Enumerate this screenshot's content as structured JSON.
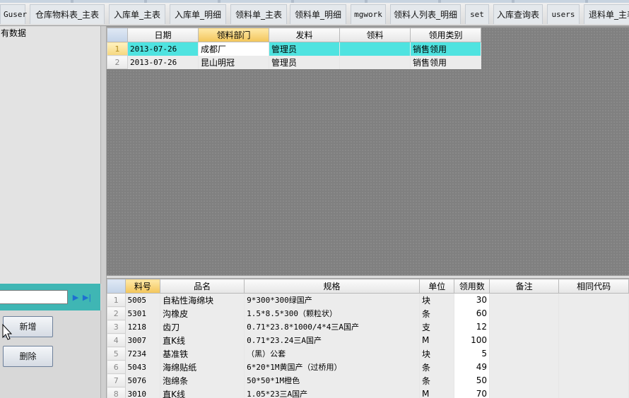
{
  "tabs": [
    "Guser",
    "仓库物料表_主表",
    "入库单_主表",
    "入库单_明细",
    "领料单_主表",
    "领料单_明细",
    "mgwork",
    "领料人列表_明细",
    "set",
    "入库查询表",
    "users",
    "退料单_主表"
  ],
  "left_panel": {
    "message": "有数据",
    "new_button": "新增",
    "delete_button": "删除",
    "nav_next": "▶",
    "nav_last": "▶|"
  },
  "top_grid": {
    "columns": [
      "日期",
      "领料部门",
      "发料",
      "领料",
      "领用类别"
    ],
    "rows": [
      {
        "num": "1",
        "cells": [
          "2013-07-26",
          "成都厂",
          "管理员",
          "",
          "销售领用"
        ]
      },
      {
        "num": "2",
        "cells": [
          "2013-07-26",
          "昆山明冠",
          "管理员",
          "",
          "销售领用"
        ]
      }
    ]
  },
  "bottom_grid": {
    "columns": [
      "料号",
      "品名",
      "规格",
      "单位",
      "领用数",
      "备注",
      "相同代码"
    ],
    "rows": [
      {
        "num": "1",
        "cells": [
          "5005",
          "自粘性海绵块",
          "9*300*300绿国产",
          "块",
          "30",
          "",
          ""
        ]
      },
      {
        "num": "2",
        "cells": [
          "5301",
          "沟橡皮",
          "1.5*8.5*300（颗粒状）",
          "条",
          "60",
          "",
          ""
        ]
      },
      {
        "num": "3",
        "cells": [
          "1218",
          "齿刀",
          "0.71*23.8*1000/4*4三A国产",
          "支",
          "12",
          "",
          ""
        ]
      },
      {
        "num": "4",
        "cells": [
          "3007",
          "直K线",
          "0.71*23.24三A国产",
          "M",
          "100",
          "",
          ""
        ]
      },
      {
        "num": "5",
        "cells": [
          "7234",
          "基准铁",
          "（黑）公套",
          "块",
          "5",
          "",
          ""
        ]
      },
      {
        "num": "6",
        "cells": [
          "5043",
          "海绵贴纸",
          "6*20*1M黄国产（过桥用）",
          "条",
          "49",
          "",
          ""
        ]
      },
      {
        "num": "7",
        "cells": [
          "5076",
          "泡绵条",
          "50*50*1M橙色",
          "条",
          "50",
          "",
          ""
        ]
      },
      {
        "num": "8",
        "cells": [
          "3010",
          "直K线",
          "1.05*23三A国产",
          "M",
          "70",
          "",
          ""
        ]
      }
    ]
  },
  "colors": {
    "selected_row": "#4fe3e0",
    "left_bar": "#3fb6b4",
    "sorted_header": "#f2c55a",
    "empty_grid": "#808080"
  }
}
